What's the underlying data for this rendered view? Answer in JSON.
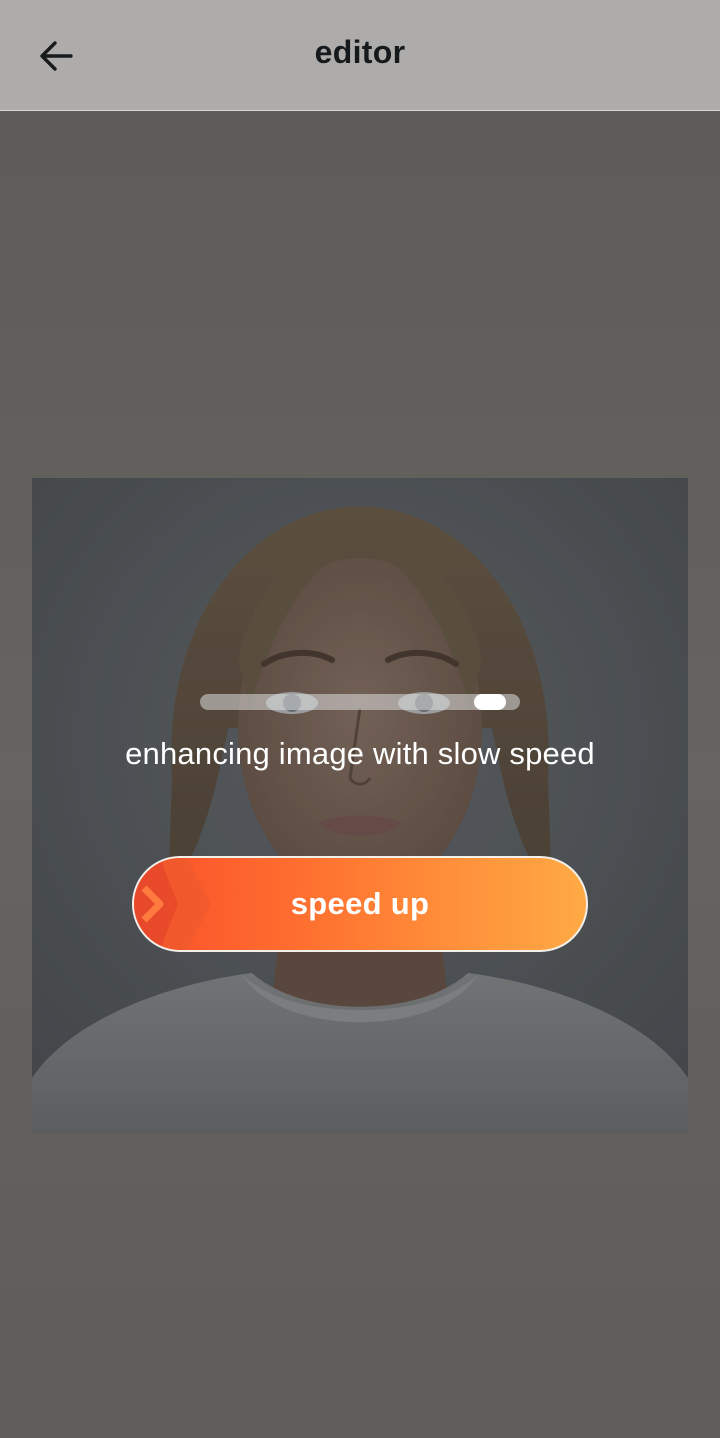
{
  "app_bar": {
    "title": "editor",
    "back_icon": "arrow-left-icon"
  },
  "progress": {
    "fraction": 0.95
  },
  "status": {
    "text": "enhancing image with slow speed"
  },
  "speed_button": {
    "label": "speed up",
    "icon": "double-chevron-right-icon"
  },
  "colors": {
    "app_bar_bg": "#adacaa",
    "overlay_bg": "#65625f",
    "button_start": "#fb4f2a",
    "button_end": "#ffaa45",
    "text_light": "#ffffff",
    "title_text": "#161a1d"
  }
}
